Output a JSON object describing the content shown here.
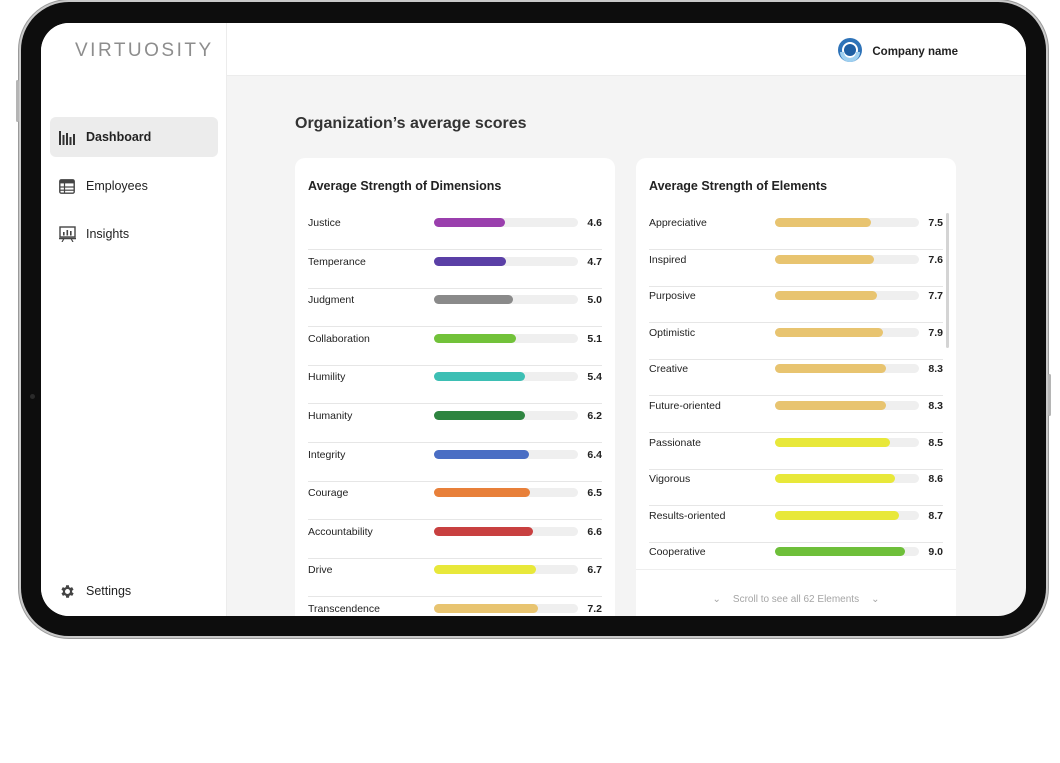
{
  "app": {
    "logo": "VIRTUOSITY",
    "company_name": "Company name"
  },
  "sidebar": {
    "items": [
      {
        "label": "Dashboard",
        "icon": "bar-chart-icon",
        "active": true
      },
      {
        "label": "Employees",
        "icon": "table-icon",
        "active": false
      },
      {
        "label": "Insights",
        "icon": "presentation-icon",
        "active": false
      }
    ],
    "settings_label": "Settings"
  },
  "main": {
    "title": "Organization’s average scores"
  },
  "dimensions": {
    "title": "Average Strength of Dimensions",
    "rows": [
      {
        "label": "Justice",
        "value": "4.6",
        "fill": 0.49,
        "color": "#9a3fad"
      },
      {
        "label": "Temperance",
        "value": "4.7",
        "fill": 0.5,
        "color": "#5a3fa6"
      },
      {
        "label": "Judgment",
        "value": "5.0",
        "fill": 0.55,
        "color": "#8a8a8a"
      },
      {
        "label": "Collaboration",
        "value": "5.1",
        "fill": 0.57,
        "color": "#72c23a"
      },
      {
        "label": "Humility",
        "value": "5.4",
        "fill": 0.63,
        "color": "#3dbfb4"
      },
      {
        "label": "Humanity",
        "value": "6.2",
        "fill": 0.63,
        "color": "#2e8440"
      },
      {
        "label": "Integrity",
        "value": "6.4",
        "fill": 0.66,
        "color": "#4a6ec4"
      },
      {
        "label": "Courage",
        "value": "6.5",
        "fill": 0.67,
        "color": "#e8803a"
      },
      {
        "label": "Accountability",
        "value": "6.6",
        "fill": 0.69,
        "color": "#c84040"
      },
      {
        "label": "Drive",
        "value": "6.7",
        "fill": 0.71,
        "color": "#e8e83a"
      },
      {
        "label": "Transcendence",
        "value": "7.2",
        "fill": 0.72,
        "color": "#e8c470"
      }
    ]
  },
  "elements": {
    "title": "Average Strength of Elements",
    "footer": "Scroll to see all 62 Elements",
    "rows": [
      {
        "label": "Appreciative",
        "value": "7.5",
        "fill": 0.67,
        "color": "#e8c470"
      },
      {
        "label": "Inspired",
        "value": "7.6",
        "fill": 0.69,
        "color": "#e8c470"
      },
      {
        "label": "Purposive",
        "value": "7.7",
        "fill": 0.71,
        "color": "#e8c470"
      },
      {
        "label": "Optimistic",
        "value": "7.9",
        "fill": 0.75,
        "color": "#e8c470"
      },
      {
        "label": "Creative",
        "value": "8.3",
        "fill": 0.77,
        "color": "#e8c470"
      },
      {
        "label": "Future-oriented",
        "value": "8.3",
        "fill": 0.77,
        "color": "#e8c470"
      },
      {
        "label": "Passionate",
        "value": "8.5",
        "fill": 0.8,
        "color": "#e8e83a"
      },
      {
        "label": "Vigorous",
        "value": "8.6",
        "fill": 0.83,
        "color": "#e8e83a"
      },
      {
        "label": "Results-oriented",
        "value": "8.7",
        "fill": 0.86,
        "color": "#e8e83a"
      },
      {
        "label": "Cooperative",
        "value": "9.0",
        "fill": 0.9,
        "color": "#6ebf3a"
      }
    ]
  }
}
